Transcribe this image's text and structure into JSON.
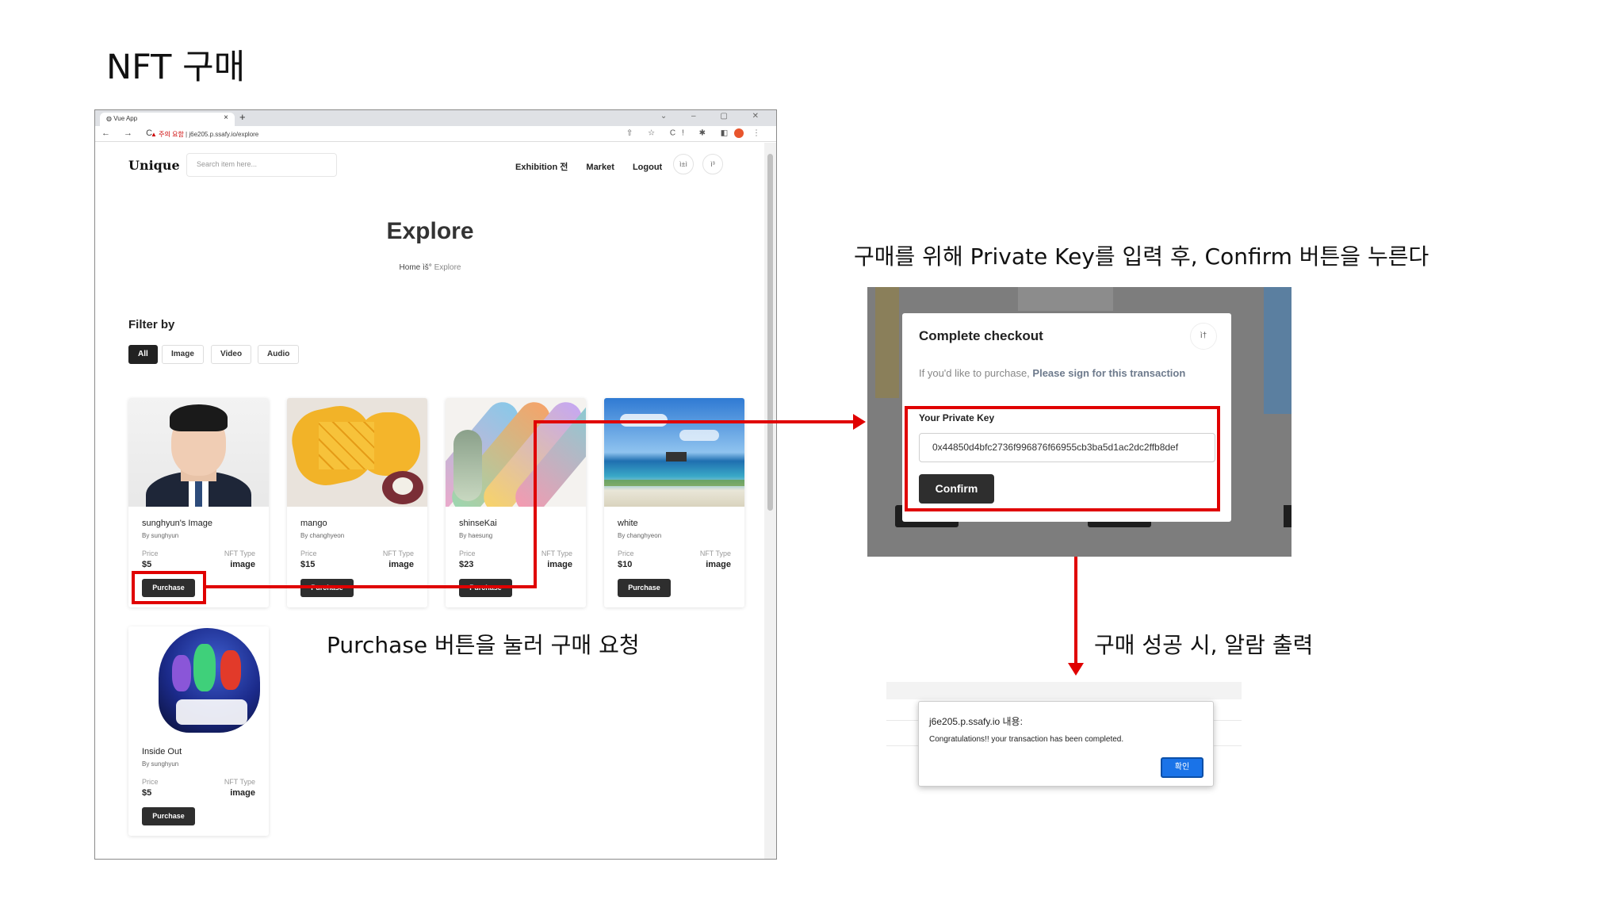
{
  "slide": {
    "title": "NFT 구매",
    "caption_modal": "구매를 위해 Private Key를 입력 후, Confirm 버튼을 누른다",
    "caption_purchase": "Purchase 버튼을 눌러 구매 요청",
    "caption_alert": "구매 성공 시, 알람 출력"
  },
  "browser": {
    "tab_title": "Vue App",
    "tab_close": "×",
    "new_tab": "+",
    "window_controls": "⌄ – ▢ ✕",
    "nav_icons": "← → C",
    "security_warning": "▲ 주의 요함",
    "url": "j6e205.p.ssafy.io/explore",
    "ext_icons": "⇧ ☆ C! ✱ ◧",
    "menu_icon": "⋮"
  },
  "site": {
    "logo": "Unique",
    "search_placeholder": "Search item here...",
    "nav": [
      "Exhibition 전",
      "Market",
      "Logout"
    ],
    "icon_btn1": "ì±ì",
    "icon_btn2": "ì³",
    "page_title": "Explore",
    "breadcrumb_home": "Home",
    "breadcrumb_sep": "ìš°",
    "breadcrumb_current": "Explore",
    "filter_title": "Filter by",
    "filters": [
      "All",
      "Image",
      "Video",
      "Audio"
    ],
    "price_label": "Price",
    "type_label": "NFT Type",
    "purchase_label": "Purchase"
  },
  "cards": [
    {
      "title": "sunghyun's Image",
      "by": "By sunghyun",
      "price": "$5",
      "type": "image"
    },
    {
      "title": "mango",
      "by": "By changhyeon",
      "price": "$15",
      "type": "image"
    },
    {
      "title": "shinseKai",
      "by": "By haesung",
      "price": "$23",
      "type": "image"
    },
    {
      "title": "white",
      "by": "By changhyeon",
      "price": "$10",
      "type": "image"
    },
    {
      "title": "Inside Out",
      "by": "By sunghyun",
      "price": "$5",
      "type": "image"
    }
  ],
  "modal": {
    "title": "Complete checkout",
    "close_icon": "ì†",
    "subtitle_plain": "If you'd like to purchase, ",
    "subtitle_bold": "Please sign for this transaction",
    "key_label": "Your Private Key",
    "key_value": "0x44850d4bfc2736f996876f66955cb3ba5d1ac2dc2ffb8def",
    "confirm": "Confirm"
  },
  "alert": {
    "title": "j6e205.p.ssafy.io 내용:",
    "message": "Congratulations!! your transaction has been completed.",
    "ok": "확인"
  },
  "colors": {
    "accent": "#e00000",
    "dark_button": "#2e2e2e",
    "alert_button": "#1a73e8"
  }
}
